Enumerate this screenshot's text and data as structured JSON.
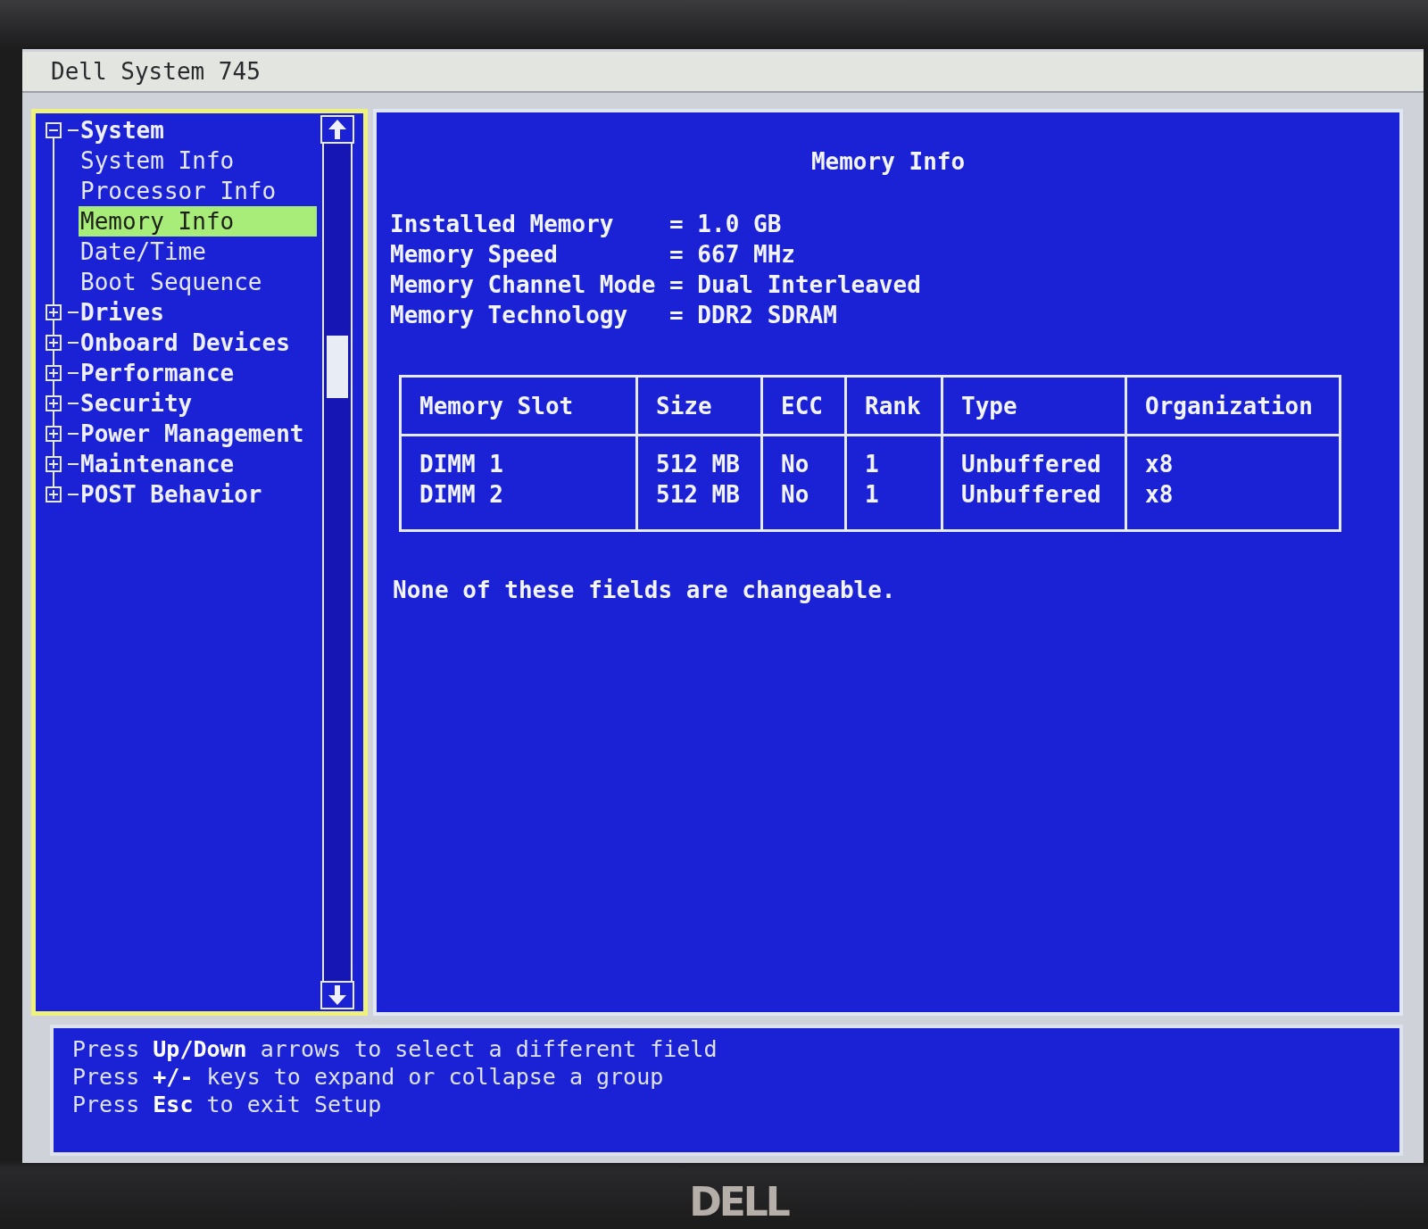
{
  "window": {
    "title": "Dell System 745"
  },
  "tree": [
    {
      "label": "System",
      "expanded": true,
      "selected": false,
      "children": [
        {
          "label": "System Info",
          "selected": false
        },
        {
          "label": "Processor Info",
          "selected": false
        },
        {
          "label": "Memory Info",
          "selected": true
        },
        {
          "label": "Date/Time",
          "selected": false
        },
        {
          "label": "Boot Sequence",
          "selected": false
        }
      ]
    },
    {
      "label": "Drives",
      "expanded": false,
      "selected": false
    },
    {
      "label": "Onboard Devices",
      "expanded": false,
      "selected": false
    },
    {
      "label": "Performance",
      "expanded": false,
      "selected": false
    },
    {
      "label": "Security",
      "expanded": false,
      "selected": false
    },
    {
      "label": "Power Management",
      "expanded": false,
      "selected": false
    },
    {
      "label": "Maintenance",
      "expanded": false,
      "selected": false
    },
    {
      "label": "POST Behavior",
      "expanded": false,
      "selected": false
    }
  ],
  "content": {
    "title": "Memory Info",
    "fields": [
      {
        "label": "Installed Memory",
        "separator": "=",
        "value": "1.0 GB"
      },
      {
        "label": "Memory Speed",
        "separator": "=",
        "value": "667 MHz"
      },
      {
        "label": "Memory Channel Mode",
        "separator": "=",
        "value": "Dual Interleaved"
      },
      {
        "label": "Memory Technology",
        "separator": "=",
        "value": "DDR2 SDRAM"
      }
    ],
    "table": {
      "columns": [
        "Memory Slot",
        "Size",
        "ECC",
        "Rank",
        "Type",
        "Organization"
      ],
      "rows": [
        [
          "DIMM 1",
          "512 MB",
          "No",
          "1",
          "Unbuffered",
          "x8"
        ],
        [
          "DIMM 2",
          "512 MB",
          "No",
          "1",
          "Unbuffered",
          "x8"
        ]
      ]
    },
    "note": "None of these fields are changeable."
  },
  "help": [
    "Press **Up/Down** arrows to select a different field",
    "Press **+/-** keys to expand or collapse a group",
    "Press **Esc** to exit Setup"
  ],
  "monitor": {
    "brand": "DELL"
  }
}
